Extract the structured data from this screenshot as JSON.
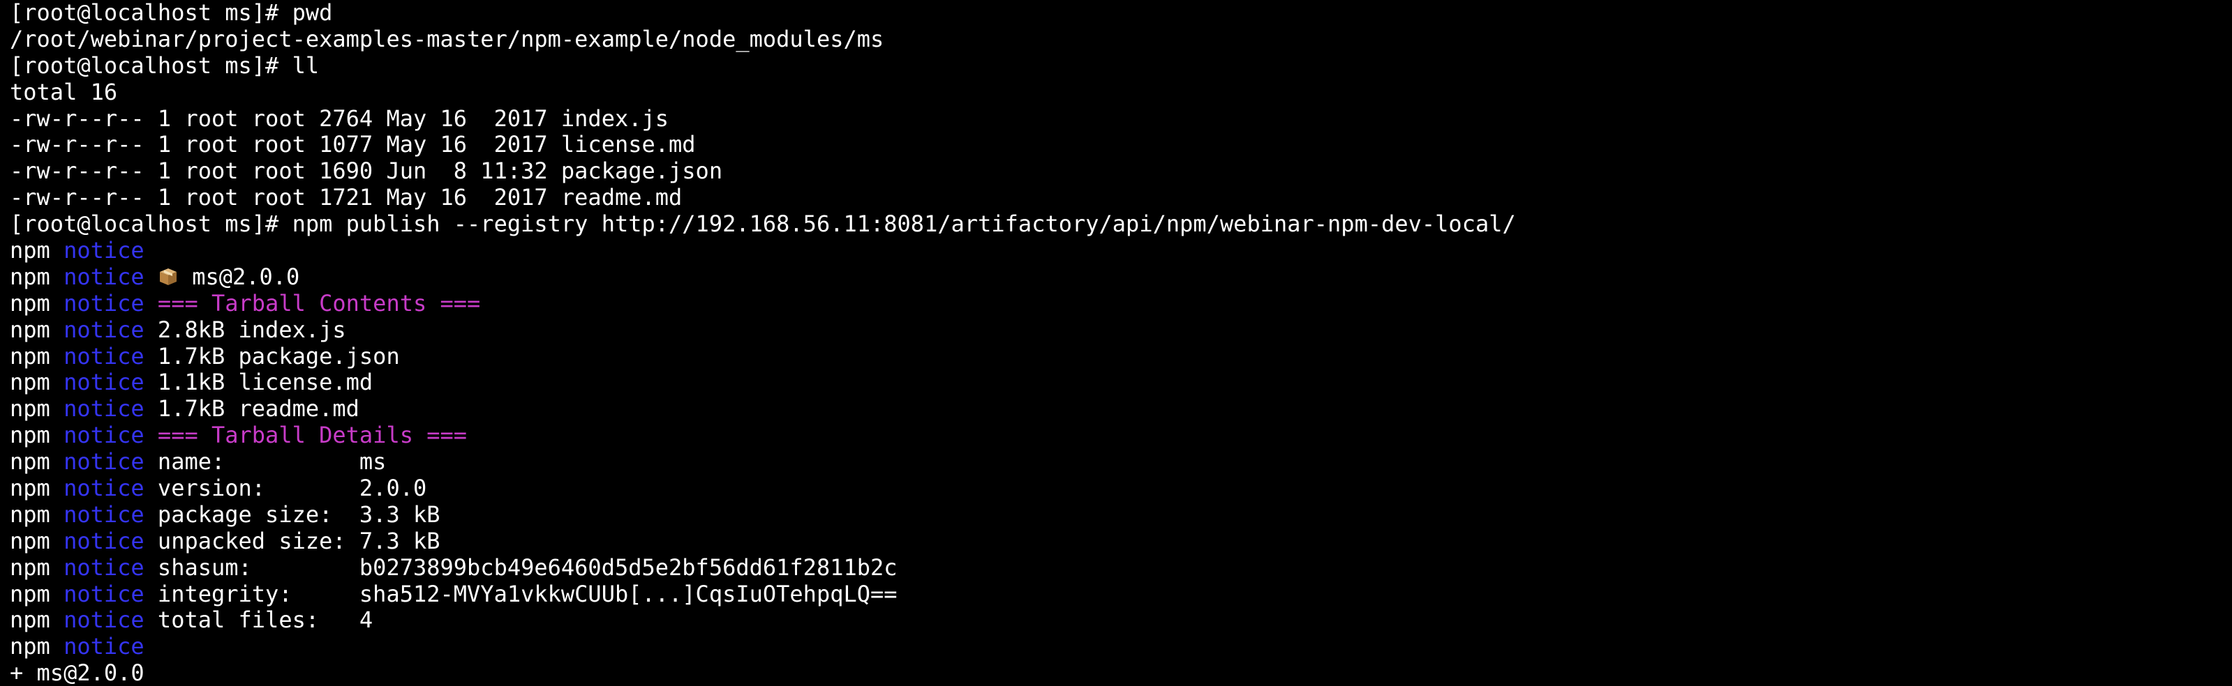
{
  "colors": {
    "background": "#000000",
    "text": "#ffffff",
    "npm_notice": "#3434f0",
    "section_header": "#c83cc8"
  },
  "lines": [
    {
      "type": "plain",
      "text": "[root@localhost ms]# pwd"
    },
    {
      "type": "plain",
      "text": "/root/webinar/project-examples-master/npm-example/node_modules/ms"
    },
    {
      "type": "plain",
      "text": "[root@localhost ms]# ll"
    },
    {
      "type": "plain",
      "text": "total 16"
    },
    {
      "type": "plain",
      "text": "-rw-r--r-- 1 root root 2764 May 16  2017 index.js"
    },
    {
      "type": "plain",
      "text": "-rw-r--r-- 1 root root 1077 May 16  2017 license.md"
    },
    {
      "type": "plain",
      "text": "-rw-r--r-- 1 root root 1690 Jun  8 11:32 package.json"
    },
    {
      "type": "plain",
      "text": "-rw-r--r-- 1 root root 1721 May 16  2017 readme.md"
    },
    {
      "type": "plain",
      "text": "[root@localhost ms]# npm publish --registry http://192.168.56.11:8081/artifactory/api/npm/webinar-npm-dev-local/"
    },
    {
      "type": "npm",
      "prefix": "npm",
      "keyword": "notice",
      "text": "",
      "style": "plain"
    },
    {
      "type": "npm",
      "prefix": "npm",
      "keyword": "notice",
      "icon": "package-icon",
      "text": "ms@2.0.0",
      "style": "plain"
    },
    {
      "type": "npm",
      "prefix": "npm",
      "keyword": "notice",
      "text": "=== Tarball Contents ===",
      "style": "mag"
    },
    {
      "type": "npm",
      "prefix": "npm",
      "keyword": "notice",
      "text": "2.8kB index.js",
      "style": "plain"
    },
    {
      "type": "npm",
      "prefix": "npm",
      "keyword": "notice",
      "text": "1.7kB package.json",
      "style": "plain"
    },
    {
      "type": "npm",
      "prefix": "npm",
      "keyword": "notice",
      "text": "1.1kB license.md",
      "style": "plain"
    },
    {
      "type": "npm",
      "prefix": "npm",
      "keyword": "notice",
      "text": "1.7kB readme.md",
      "style": "plain"
    },
    {
      "type": "npm",
      "prefix": "npm",
      "keyword": "notice",
      "text": "=== Tarball Details ===",
      "style": "mag"
    },
    {
      "type": "npm",
      "prefix": "npm",
      "keyword": "notice",
      "text": "name:          ms",
      "style": "plain"
    },
    {
      "type": "npm",
      "prefix": "npm",
      "keyword": "notice",
      "text": "version:       2.0.0",
      "style": "plain"
    },
    {
      "type": "npm",
      "prefix": "npm",
      "keyword": "notice",
      "text": "package size:  3.3 kB",
      "style": "plain"
    },
    {
      "type": "npm",
      "prefix": "npm",
      "keyword": "notice",
      "text": "unpacked size: 7.3 kB",
      "style": "plain"
    },
    {
      "type": "npm",
      "prefix": "npm",
      "keyword": "notice",
      "text": "shasum:        b0273899bcb49e6460d5d5e2bf56dd61f2811b2c",
      "style": "plain"
    },
    {
      "type": "npm",
      "prefix": "npm",
      "keyword": "notice",
      "text": "integrity:     sha512-MVYa1vkkwCUUb[...]CqsIuOTehpqLQ==",
      "style": "plain"
    },
    {
      "type": "npm",
      "prefix": "npm",
      "keyword": "notice",
      "text": "total files:   4",
      "style": "plain"
    },
    {
      "type": "npm",
      "prefix": "npm",
      "keyword": "notice",
      "text": "",
      "style": "plain"
    },
    {
      "type": "plain",
      "text": "+ ms@2.0.0"
    }
  ]
}
